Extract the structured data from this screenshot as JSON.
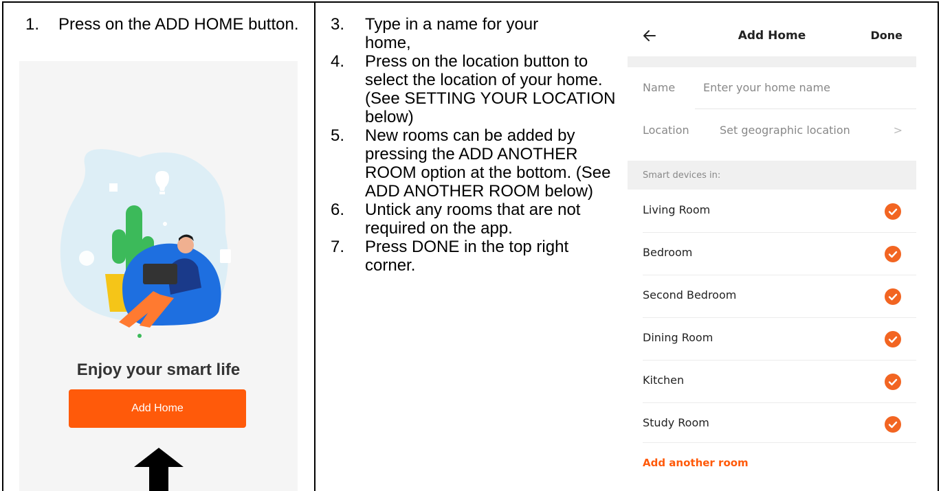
{
  "left": {
    "step_number": "1.",
    "step_text": "Press on the ADD HOME button.",
    "tagline": "Enjoy your smart life",
    "button_label": "Add Home"
  },
  "middle": {
    "steps": [
      {
        "num": "3.",
        "text": "Type in a name for your home,"
      },
      {
        "num": "4.",
        "text": "Press on the location button to select the location of your home.  (See SETTING YOUR LOCATION below)"
      },
      {
        "num": "5.",
        "text": "New rooms can be added by pressing the ADD ANOTHER ROOM option at the bottom. (See ADD ANOTHER ROOM below)"
      },
      {
        "num": "6.",
        "text": "Untick any rooms that are not required on the app."
      },
      {
        "num": "7.",
        "text": "Press DONE in the top right corner."
      }
    ]
  },
  "right": {
    "title": "Add Home",
    "done_label": "Done",
    "name_label": "Name",
    "name_placeholder": "Enter your home name",
    "location_label": "Location",
    "location_value": "Set geographic location",
    "location_chevron": ">",
    "section_label": "Smart devices in:",
    "rooms": [
      {
        "name": "Living Room",
        "checked": true
      },
      {
        "name": "Bedroom",
        "checked": true
      },
      {
        "name": "Second Bedroom",
        "checked": true
      },
      {
        "name": "Dining Room",
        "checked": true
      },
      {
        "name": "Kitchen",
        "checked": true
      },
      {
        "name": "Study Room",
        "checked": true
      }
    ],
    "add_room_label": "Add another room"
  },
  "colors": {
    "accent": "#ff5a0a",
    "check": "#f26522",
    "panel_bg": "#f5f5f5",
    "illustration_blob": "#ddeef6",
    "beanbag": "#1e6fe0"
  }
}
